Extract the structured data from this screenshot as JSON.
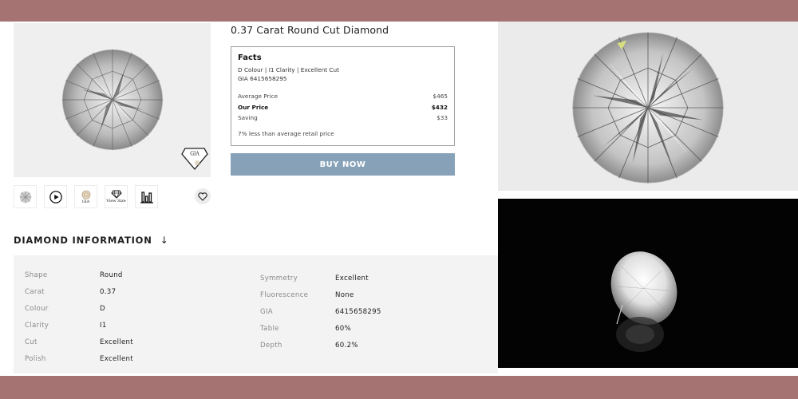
{
  "product": {
    "title": "0.37 Carat Round Cut Diamond"
  },
  "gallery": {
    "main_image": "round-diamond-image",
    "badge_label": "GIA",
    "thumbnails": [
      {
        "name": "diamond-thumbnail",
        "icon": "diamond-photo",
        "label": ""
      },
      {
        "name": "video-thumbnail",
        "icon": "play-icon",
        "label": ""
      },
      {
        "name": "certificate-thumbnail",
        "icon": "gia-seal-icon",
        "label": "GIA"
      },
      {
        "name": "view-size-thumbnail",
        "icon": "diamond-outline-icon",
        "label": "View Size"
      },
      {
        "name": "chart-thumbnail",
        "icon": "bar-chart-icon",
        "label": ""
      }
    ],
    "wishlist_icon": "heart-icon"
  },
  "facts": {
    "heading": "Facts",
    "summary": "D Colour | I1 Clarity | Excellent Cut",
    "certificate": "GIA 6415658295",
    "prices": [
      {
        "label": "Average Price",
        "value": "$465",
        "bold": false
      },
      {
        "label": "Our Price",
        "value": "$432",
        "bold": true
      },
      {
        "label": "Saving",
        "value": "$33",
        "bold": false
      }
    ],
    "note": "7% less than average retail price"
  },
  "buy_button": "BUY NOW",
  "diamond_info": {
    "heading": "DIAMOND INFORMATION",
    "arrow": "↓",
    "left": [
      {
        "label": "Shape",
        "value": "Round"
      },
      {
        "label": "Carat",
        "value": "0.37"
      },
      {
        "label": "Colour",
        "value": "D"
      },
      {
        "label": "Clarity",
        "value": "I1"
      },
      {
        "label": "Cut",
        "value": "Excellent"
      },
      {
        "label": "Polish",
        "value": "Excellent"
      }
    ],
    "right": [
      {
        "label": "Symmetry",
        "value": "Excellent"
      },
      {
        "label": "Fluorescence",
        "value": "None"
      },
      {
        "label": "GIA",
        "value": "6415658295"
      },
      {
        "label": "Table",
        "value": "60%"
      },
      {
        "label": "Depth",
        "value": "60.2%"
      }
    ]
  },
  "colors": {
    "frame_band": "#a57372",
    "buy_button": "#87a2b8",
    "info_panel": "#f3f3f3"
  }
}
